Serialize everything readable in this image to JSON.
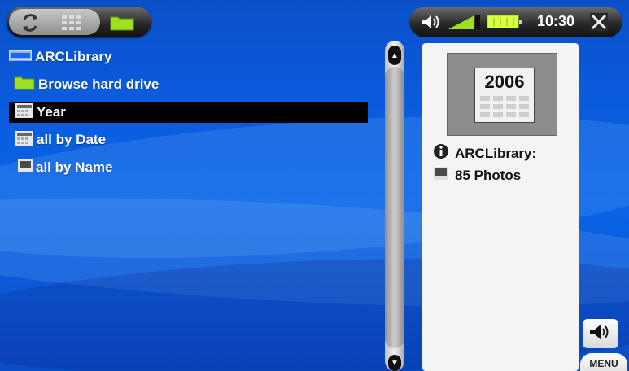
{
  "top_nav": {
    "icons": [
      "refresh-icon",
      "grid-view-icon",
      "folder-icon"
    ]
  },
  "status_bar": {
    "icons": [
      "speaker-icon",
      "volume-level-icon",
      "battery-icon",
      "close-icon"
    ],
    "time": "10:30"
  },
  "list": {
    "items": [
      {
        "label": "ARCLibrary",
        "icon": "library-icon",
        "selected": false
      },
      {
        "label": "Browse hard drive",
        "icon": "folder-icon",
        "selected": false
      },
      {
        "label": "Year",
        "icon": "calendar-icon",
        "selected": true
      },
      {
        "label": "all by Date",
        "icon": "calendar-icon",
        "selected": false
      },
      {
        "label": "all by Name",
        "icon": "photo-icon",
        "selected": false
      }
    ]
  },
  "scrollbar": {
    "up_icon": "arrow-up-icon",
    "down_icon": "arrow-down-icon"
  },
  "info_panel": {
    "thumbnail_text": "2006",
    "library_label": "ARCLibrary:",
    "count_text": "85 Photos",
    "info_icon": "info-icon",
    "photo_icon": "photo-icon"
  },
  "buttons": {
    "volume_icon": "speaker-icon",
    "menu_label": "MENU"
  },
  "colors": {
    "background_blue": "#0b5bdc",
    "selection": "#000000",
    "panel_bg": "#f4f4f4",
    "folder_green": "#9fe01f"
  }
}
